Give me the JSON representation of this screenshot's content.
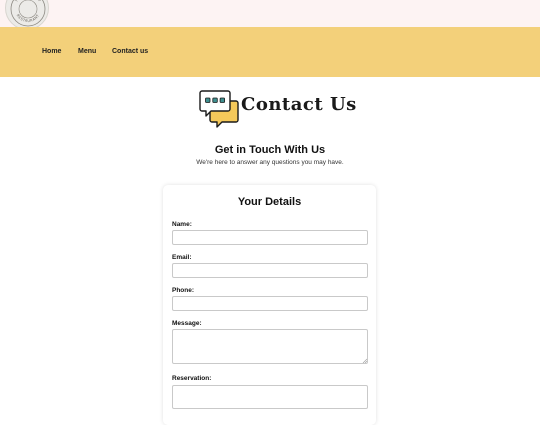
{
  "brand": {
    "logo_text": "THE BEAUTY RESTAURANT"
  },
  "nav": {
    "items": [
      {
        "label": "Home"
      },
      {
        "label": "Menu"
      },
      {
        "label": "Contact us"
      }
    ]
  },
  "hero": {
    "title": "Contact Us",
    "icon": "chat-bubble-icon"
  },
  "intro": {
    "heading": "Get in Touch With Us",
    "subtext": "We're here to answer any questions you may have."
  },
  "form": {
    "title": "Your Details",
    "fields": {
      "name": {
        "label": "Name:",
        "value": ""
      },
      "email": {
        "label": "Email:",
        "value": ""
      },
      "phone": {
        "label": "Phone:",
        "value": ""
      },
      "message": {
        "label": "Message:",
        "value": ""
      },
      "reservation": {
        "label": "Reservation:",
        "value": ""
      }
    }
  },
  "colors": {
    "topbar": "#fdf3f3",
    "navbar": "#f3d07a",
    "accent": "#f5c95a"
  }
}
